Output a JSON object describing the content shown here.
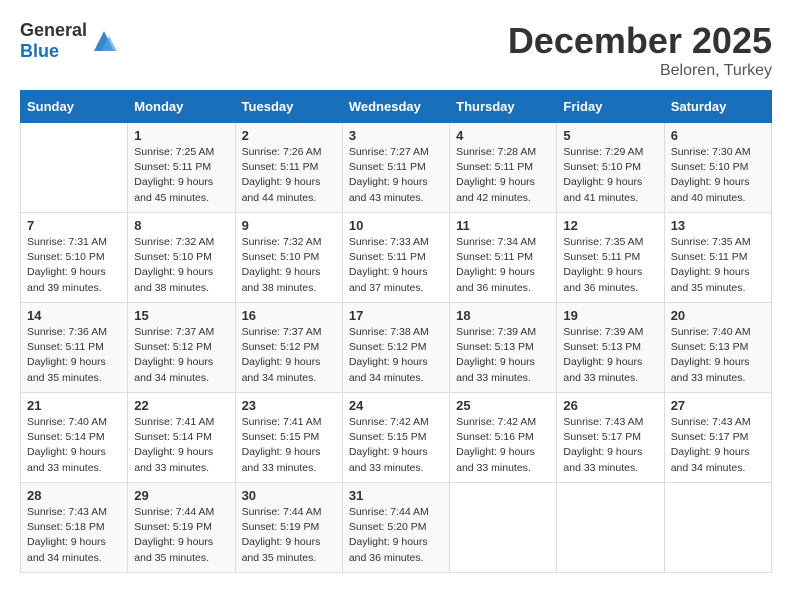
{
  "logo": {
    "text_general": "General",
    "text_blue": "Blue"
  },
  "title": {
    "month_year": "December 2025",
    "location": "Beloren, Turkey"
  },
  "days_of_week": [
    "Sunday",
    "Monday",
    "Tuesday",
    "Wednesday",
    "Thursday",
    "Friday",
    "Saturday"
  ],
  "weeks": [
    [
      {
        "day": "",
        "info": ""
      },
      {
        "day": "1",
        "info": "Sunrise: 7:25 AM\nSunset: 5:11 PM\nDaylight: 9 hours\nand 45 minutes."
      },
      {
        "day": "2",
        "info": "Sunrise: 7:26 AM\nSunset: 5:11 PM\nDaylight: 9 hours\nand 44 minutes."
      },
      {
        "day": "3",
        "info": "Sunrise: 7:27 AM\nSunset: 5:11 PM\nDaylight: 9 hours\nand 43 minutes."
      },
      {
        "day": "4",
        "info": "Sunrise: 7:28 AM\nSunset: 5:11 PM\nDaylight: 9 hours\nand 42 minutes."
      },
      {
        "day": "5",
        "info": "Sunrise: 7:29 AM\nSunset: 5:10 PM\nDaylight: 9 hours\nand 41 minutes."
      },
      {
        "day": "6",
        "info": "Sunrise: 7:30 AM\nSunset: 5:10 PM\nDaylight: 9 hours\nand 40 minutes."
      }
    ],
    [
      {
        "day": "7",
        "info": "Sunrise: 7:31 AM\nSunset: 5:10 PM\nDaylight: 9 hours\nand 39 minutes."
      },
      {
        "day": "8",
        "info": "Sunrise: 7:32 AM\nSunset: 5:10 PM\nDaylight: 9 hours\nand 38 minutes."
      },
      {
        "day": "9",
        "info": "Sunrise: 7:32 AM\nSunset: 5:10 PM\nDaylight: 9 hours\nand 38 minutes."
      },
      {
        "day": "10",
        "info": "Sunrise: 7:33 AM\nSunset: 5:11 PM\nDaylight: 9 hours\nand 37 minutes."
      },
      {
        "day": "11",
        "info": "Sunrise: 7:34 AM\nSunset: 5:11 PM\nDaylight: 9 hours\nand 36 minutes."
      },
      {
        "day": "12",
        "info": "Sunrise: 7:35 AM\nSunset: 5:11 PM\nDaylight: 9 hours\nand 36 minutes."
      },
      {
        "day": "13",
        "info": "Sunrise: 7:35 AM\nSunset: 5:11 PM\nDaylight: 9 hours\nand 35 minutes."
      }
    ],
    [
      {
        "day": "14",
        "info": "Sunrise: 7:36 AM\nSunset: 5:11 PM\nDaylight: 9 hours\nand 35 minutes."
      },
      {
        "day": "15",
        "info": "Sunrise: 7:37 AM\nSunset: 5:12 PM\nDaylight: 9 hours\nand 34 minutes."
      },
      {
        "day": "16",
        "info": "Sunrise: 7:37 AM\nSunset: 5:12 PM\nDaylight: 9 hours\nand 34 minutes."
      },
      {
        "day": "17",
        "info": "Sunrise: 7:38 AM\nSunset: 5:12 PM\nDaylight: 9 hours\nand 34 minutes."
      },
      {
        "day": "18",
        "info": "Sunrise: 7:39 AM\nSunset: 5:13 PM\nDaylight: 9 hours\nand 33 minutes."
      },
      {
        "day": "19",
        "info": "Sunrise: 7:39 AM\nSunset: 5:13 PM\nDaylight: 9 hours\nand 33 minutes."
      },
      {
        "day": "20",
        "info": "Sunrise: 7:40 AM\nSunset: 5:13 PM\nDaylight: 9 hours\nand 33 minutes."
      }
    ],
    [
      {
        "day": "21",
        "info": "Sunrise: 7:40 AM\nSunset: 5:14 PM\nDaylight: 9 hours\nand 33 minutes."
      },
      {
        "day": "22",
        "info": "Sunrise: 7:41 AM\nSunset: 5:14 PM\nDaylight: 9 hours\nand 33 minutes."
      },
      {
        "day": "23",
        "info": "Sunrise: 7:41 AM\nSunset: 5:15 PM\nDaylight: 9 hours\nand 33 minutes."
      },
      {
        "day": "24",
        "info": "Sunrise: 7:42 AM\nSunset: 5:15 PM\nDaylight: 9 hours\nand 33 minutes."
      },
      {
        "day": "25",
        "info": "Sunrise: 7:42 AM\nSunset: 5:16 PM\nDaylight: 9 hours\nand 33 minutes."
      },
      {
        "day": "26",
        "info": "Sunrise: 7:43 AM\nSunset: 5:17 PM\nDaylight: 9 hours\nand 33 minutes."
      },
      {
        "day": "27",
        "info": "Sunrise: 7:43 AM\nSunset: 5:17 PM\nDaylight: 9 hours\nand 34 minutes."
      }
    ],
    [
      {
        "day": "28",
        "info": "Sunrise: 7:43 AM\nSunset: 5:18 PM\nDaylight: 9 hours\nand 34 minutes."
      },
      {
        "day": "29",
        "info": "Sunrise: 7:44 AM\nSunset: 5:19 PM\nDaylight: 9 hours\nand 35 minutes."
      },
      {
        "day": "30",
        "info": "Sunrise: 7:44 AM\nSunset: 5:19 PM\nDaylight: 9 hours\nand 35 minutes."
      },
      {
        "day": "31",
        "info": "Sunrise: 7:44 AM\nSunset: 5:20 PM\nDaylight: 9 hours\nand 36 minutes."
      },
      {
        "day": "",
        "info": ""
      },
      {
        "day": "",
        "info": ""
      },
      {
        "day": "",
        "info": ""
      }
    ]
  ]
}
